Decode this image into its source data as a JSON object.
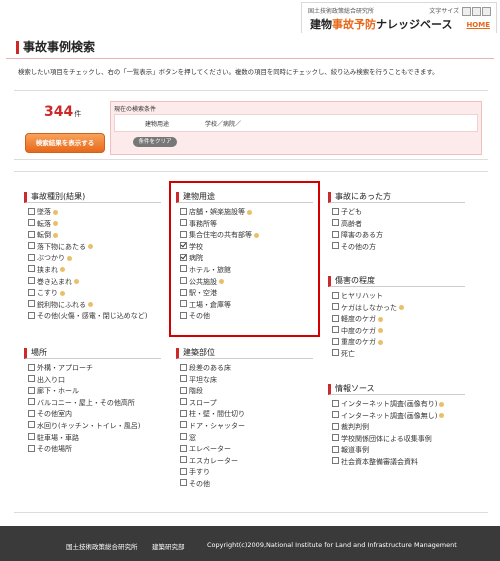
{
  "header": {
    "org": "国土技術政策総合研究所",
    "font_size_label": "文字サイズ",
    "title_part1": "建物",
    "title_part2": "事故予防",
    "title_part3": "ナレッジベース",
    "home_link": "HOME"
  },
  "page": {
    "title": "事故事例検索",
    "instruction": "検索したい項目をチェックし、右の「一覧表示」ボタンを押してください。複数の項目を同時にチェックし、絞り込み検索を行うこともできます。"
  },
  "result": {
    "count": "344",
    "count_unit": "件",
    "show_button": "検索結果を表示する",
    "current_conditions_label": "現在の検索条件",
    "condition_label": "建物用途",
    "condition_value": "学校／病院／",
    "clear_button": "条件をクリア"
  },
  "groups": {
    "accident_type": {
      "title": "事故種別(結果)",
      "items": [
        {
          "label": "墜落",
          "help": true
        },
        {
          "label": "転落",
          "help": true
        },
        {
          "label": "転倒",
          "help": true
        },
        {
          "label": "落下物にあたる",
          "help": true
        },
        {
          "label": "ぶつかり",
          "help": true
        },
        {
          "label": "挟まれ",
          "help": true
        },
        {
          "label": "巻き込まれ",
          "help": true
        },
        {
          "label": "こすり",
          "help": true
        },
        {
          "label": "鋭利物にふれる",
          "help": true
        },
        {
          "label": "その他(火傷・感電・閉じ込めなど)",
          "help": false
        }
      ]
    },
    "building_use": {
      "title": "建物用途",
      "items": [
        {
          "label": "店舗・娯楽施設等",
          "help": true,
          "checked": false
        },
        {
          "label": "事務所等",
          "help": false,
          "checked": false
        },
        {
          "label": "集合住宅の共有部等",
          "help": true,
          "checked": false
        },
        {
          "label": "学校",
          "help": false,
          "checked": true
        },
        {
          "label": "病院",
          "help": false,
          "checked": true
        },
        {
          "label": "ホテル・旅館",
          "help": false,
          "checked": false
        },
        {
          "label": "公共施設",
          "help": true,
          "checked": false
        },
        {
          "label": "駅・空港",
          "help": false,
          "checked": false
        },
        {
          "label": "工場・倉庫等",
          "help": false,
          "checked": false
        },
        {
          "label": "その他",
          "help": false,
          "checked": false
        }
      ]
    },
    "victim": {
      "title": "事故にあった方",
      "items": [
        {
          "label": "子ども",
          "help": false
        },
        {
          "label": "高齢者",
          "help": false
        },
        {
          "label": "障害のある方",
          "help": false
        },
        {
          "label": "その他の方",
          "help": false
        }
      ]
    },
    "injury": {
      "title": "傷害の程度",
      "items": [
        {
          "label": "ヒヤリハット",
          "help": false
        },
        {
          "label": "ケガはしなかった",
          "help": true
        },
        {
          "label": "軽度のケガ",
          "help": true
        },
        {
          "label": "中度のケガ",
          "help": true
        },
        {
          "label": "重度のケガ",
          "help": true
        },
        {
          "label": "死亡",
          "help": false
        }
      ]
    },
    "location": {
      "title": "場所",
      "items": [
        {
          "label": "外構・アプローチ",
          "help": false
        },
        {
          "label": "出入り口",
          "help": false
        },
        {
          "label": "廊下・ホール",
          "help": false
        },
        {
          "label": "バルコニー・屋上・その他高所",
          "help": false
        },
        {
          "label": "その他室内",
          "help": false
        },
        {
          "label": "水回り(キッチン・トイレ・風呂)",
          "help": false
        },
        {
          "label": "駐車場・車路",
          "help": false
        },
        {
          "label": "その他場所",
          "help": false
        }
      ]
    },
    "building_part": {
      "title": "建築部位",
      "items": [
        {
          "label": "段差のある床",
          "help": false
        },
        {
          "label": "平坦な床",
          "help": false
        },
        {
          "label": "階段",
          "help": false
        },
        {
          "label": "スロープ",
          "help": false
        },
        {
          "label": "柱・壁・間仕切り",
          "help": false
        },
        {
          "label": "ドア・シャッター",
          "help": false
        },
        {
          "label": "窓",
          "help": false
        },
        {
          "label": "エレベーター",
          "help": false
        },
        {
          "label": "エスカレーター",
          "help": false
        },
        {
          "label": "手すり",
          "help": false
        },
        {
          "label": "その他",
          "help": false
        }
      ]
    },
    "info_source": {
      "title": "情報ソース",
      "items": [
        {
          "label": "インターネット調査(画像有り)",
          "help": true
        },
        {
          "label": "インターネット調査(画像無し)",
          "help": true
        },
        {
          "label": "裁判判例",
          "help": false
        },
        {
          "label": "学校関係団体による収集事例",
          "help": false
        },
        {
          "label": "報道事例",
          "help": false
        },
        {
          "label": "社会資本整備審議会資料",
          "help": false
        }
      ]
    }
  },
  "footer": {
    "org": "国土技術政策総合研究所",
    "lab": "建築研究部",
    "copyright": "Copyright(c)2009,National Institute for Land and Infrastructure Management"
  }
}
